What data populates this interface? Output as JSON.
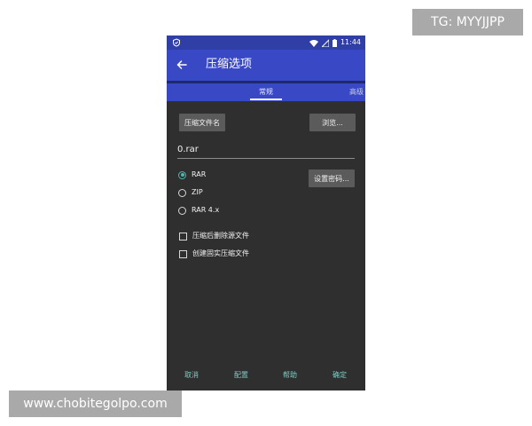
{
  "watermarks": {
    "top": "TG: MYYJJPP",
    "bottom": "www.chobitegolpo.com"
  },
  "status_bar": {
    "time": "11:44",
    "icons": [
      "shield-icon",
      "wifi-icon",
      "signal-icon",
      "battery-icon"
    ]
  },
  "app_bar": {
    "title": "压缩选项",
    "back_icon": "arrow-back-icon",
    "color": "#3949c5"
  },
  "tabs": [
    {
      "label": "常规",
      "selected": true
    },
    {
      "label": "高级",
      "selected": false
    }
  ],
  "main": {
    "archive_name_button": "压缩文件名",
    "browse_button": "浏览...",
    "filename_value": "0.rar",
    "set_password_button": "设置密码...",
    "formats": [
      {
        "label": "RAR",
        "selected": true
      },
      {
        "label": "ZIP",
        "selected": false
      },
      {
        "label": "RAR 4.x",
        "selected": false
      }
    ],
    "options": [
      {
        "label": "压缩后删除源文件",
        "checked": false
      },
      {
        "label": "创建固实压缩文件",
        "checked": false
      }
    ]
  },
  "bottom_actions": {
    "cancel": "取消",
    "config": "配置",
    "help": "帮助",
    "ok": "确定"
  },
  "colors": {
    "accent": "#4db6ac",
    "background": "#2f2f2f",
    "button": "#5b5b5b"
  }
}
